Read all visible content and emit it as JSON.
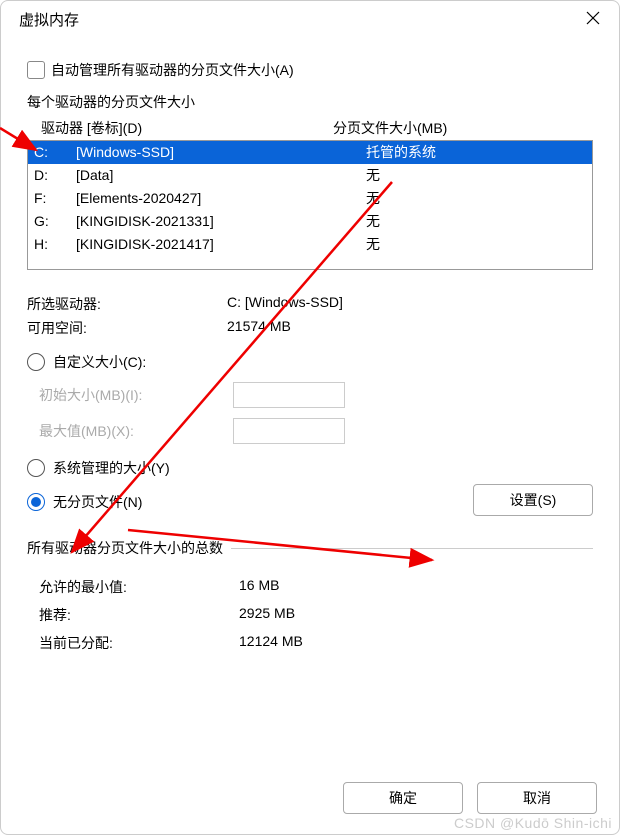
{
  "window": {
    "title": "虚拟内存"
  },
  "auto_manage": {
    "label": "自动管理所有驱动器的分页文件大小(A)",
    "checked": false
  },
  "group_label": "每个驱动器的分页文件大小",
  "drive_header": {
    "col1": "驱动器 [卷标](D)",
    "col2": "分页文件大小(MB)"
  },
  "drives": [
    {
      "letter": "C:",
      "label": "[Windows-SSD]",
      "size": "托管的系统",
      "selected": true
    },
    {
      "letter": "D:",
      "label": "[Data]",
      "size": "无",
      "selected": false
    },
    {
      "letter": "F:",
      "label": "[Elements-2020427]",
      "size": "无",
      "selected": false
    },
    {
      "letter": "G:",
      "label": "[KINGIDISK-2021331]",
      "size": "无",
      "selected": false
    },
    {
      "letter": "H:",
      "label": "[KINGIDISK-2021417]",
      "size": "无",
      "selected": false
    }
  ],
  "selected_drive": {
    "label": "所选驱动器:",
    "value": "C:  [Windows-SSD]"
  },
  "free_space": {
    "label": "可用空间:",
    "value": "21574 MB"
  },
  "radio_custom": {
    "label": "自定义大小(C):",
    "checked": false
  },
  "initial_size": {
    "label": "初始大小(MB)(I):"
  },
  "max_size": {
    "label": "最大值(MB)(X):"
  },
  "radio_system": {
    "label": "系统管理的大小(Y)",
    "checked": false
  },
  "radio_none": {
    "label": "无分页文件(N)",
    "checked": true
  },
  "set_button": "设置(S)",
  "totals_group": "所有驱动器分页文件大小的总数",
  "totals": {
    "min": {
      "label": "允许的最小值:",
      "value": "16 MB"
    },
    "rec": {
      "label": "推荐:",
      "value": "2925 MB"
    },
    "cur": {
      "label": "当前已分配:",
      "value": "12124 MB"
    }
  },
  "ok": "确定",
  "cancel": "取消",
  "watermark": "CSDN @Kudō Shin-ichi"
}
